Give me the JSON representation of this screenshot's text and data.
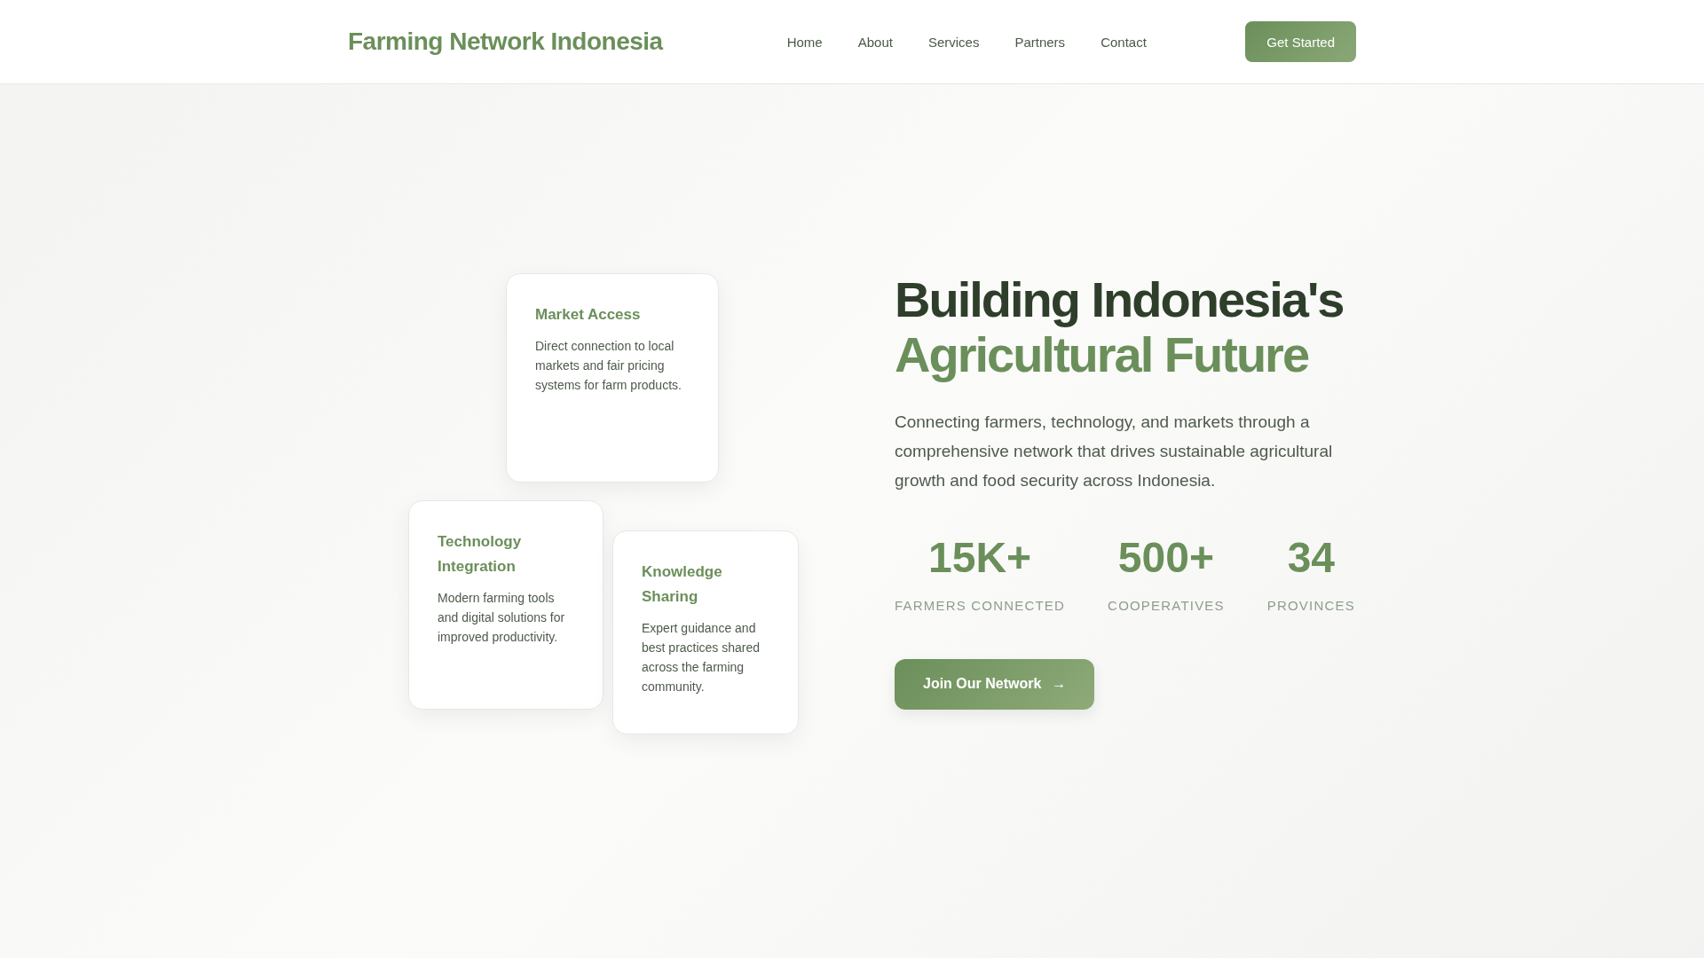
{
  "header": {
    "logo": "Farming Network Indonesia",
    "nav": [
      {
        "label": "Home"
      },
      {
        "label": "About"
      },
      {
        "label": "Services"
      },
      {
        "label": "Partners"
      },
      {
        "label": "Contact"
      }
    ],
    "cta": "Get Started"
  },
  "feature_cards": [
    {
      "title": "Market Access",
      "text": "Direct connection to local markets and fair pricing systems for farm products."
    },
    {
      "title": "Technology Integration",
      "text": "Modern farming tools and digital solutions for improved productivity."
    },
    {
      "title": "Knowledge Sharing",
      "text": "Expert guidance and best practices shared across the farming community."
    }
  ],
  "hero": {
    "title_line_1": "Building Indonesia's",
    "title_line_2": "Agricultural Future",
    "description": "Connecting farmers, technology, and markets through a comprehensive network that drives sustainable agricultural growth and food security across Indonesia.",
    "stats": [
      {
        "value": "15K+",
        "label": "FARMERS CONNECTED"
      },
      {
        "value": "500+",
        "label": "COOPERATIVES"
      },
      {
        "value": "34",
        "label": "PROVINCES"
      }
    ],
    "button": {
      "label": "Join Our Network",
      "arrow": "→"
    }
  }
}
